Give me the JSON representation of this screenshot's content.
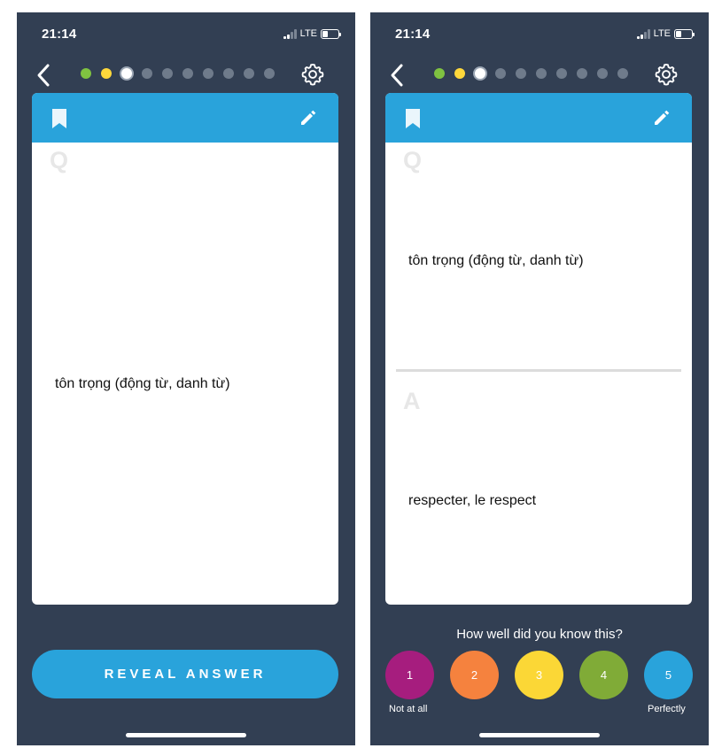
{
  "status_bar": {
    "time": "21:14",
    "network": "LTE"
  },
  "progress": {
    "total_steps": 10,
    "current_step": 3
  },
  "colors": {
    "background": "#323f53",
    "accent": "#29a3db",
    "progress_done_1": "#7fc241",
    "progress_done_2": "#ffd83b",
    "rating_1": "#a61d7e",
    "rating_2": "#f5823e",
    "rating_3": "#fbd736",
    "rating_4": "#80ab37",
    "rating_5": "#29a3db"
  },
  "icons": {
    "back": "chevron-left-icon",
    "settings": "gear-icon",
    "bookmark": "bookmark-icon",
    "edit": "pencil-icon"
  },
  "left_screen": {
    "question_letter": "Q",
    "question_text": "tôn trọng (động từ, danh từ)",
    "reveal_button_label": "REVEAL ANSWER"
  },
  "right_screen": {
    "question_letter": "Q",
    "question_text": "tôn trọng (động từ, danh từ)",
    "answer_letter": "A",
    "answer_text": "respecter, le respect",
    "rating_prompt": "How well did you know this?",
    "ratings": [
      {
        "label": "1"
      },
      {
        "label": "2"
      },
      {
        "label": "3"
      },
      {
        "label": "4"
      },
      {
        "label": "5"
      }
    ],
    "rating_min_caption": "Not at all",
    "rating_max_caption": "Perfectly"
  }
}
